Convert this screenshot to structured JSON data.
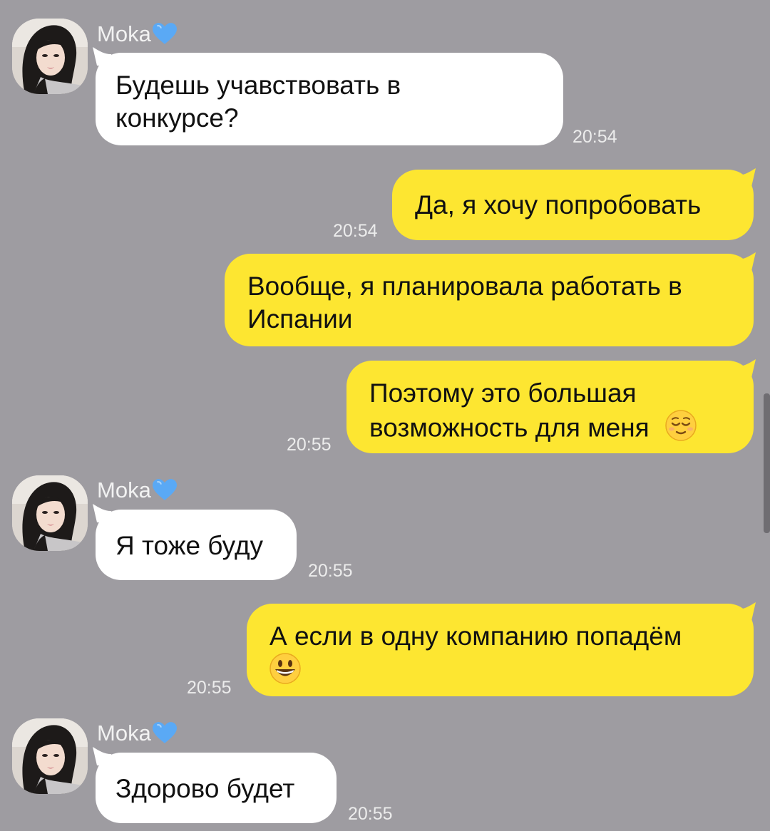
{
  "chat": {
    "contact_name": "Moka",
    "messages": [
      {
        "from": "contact",
        "sender": "Moka",
        "lines": [
          "Будешь учавствовать в",
          "конкурсе?"
        ],
        "time": "20:54"
      },
      {
        "from": "me",
        "lines": [
          "Да, я хочу попробовать"
        ],
        "time": "20:54"
      },
      {
        "from": "me",
        "lines": [
          "Вообще, я планировала работать в",
          "Испании"
        ],
        "time": ""
      },
      {
        "from": "me",
        "lines": [
          "Поэтому это большая",
          "возможность для меня"
        ],
        "emoji": "relieved-face",
        "time": "20:55"
      },
      {
        "from": "contact",
        "sender": "Moka",
        "lines": [
          "Я тоже буду"
        ],
        "time": "20:55"
      },
      {
        "from": "me",
        "lines": [
          "А если в одну компанию попадём"
        ],
        "emoji": "grinning-face",
        "time": "20:55"
      },
      {
        "from": "contact",
        "sender": "Moka",
        "lines": [
          "Здорово будет"
        ],
        "time": "20:55"
      }
    ]
  },
  "colors": {
    "background": "#9e9ca1",
    "outgoing_bubble": "#fde631",
    "incoming_bubble": "#ffffff",
    "timestamp": "#ececec",
    "heart": "#5aa9f5"
  },
  "icons": {
    "heart": "blue-heart-icon",
    "relieved": "relieved-face-emoji",
    "grinning": "grinning-face-emoji"
  }
}
